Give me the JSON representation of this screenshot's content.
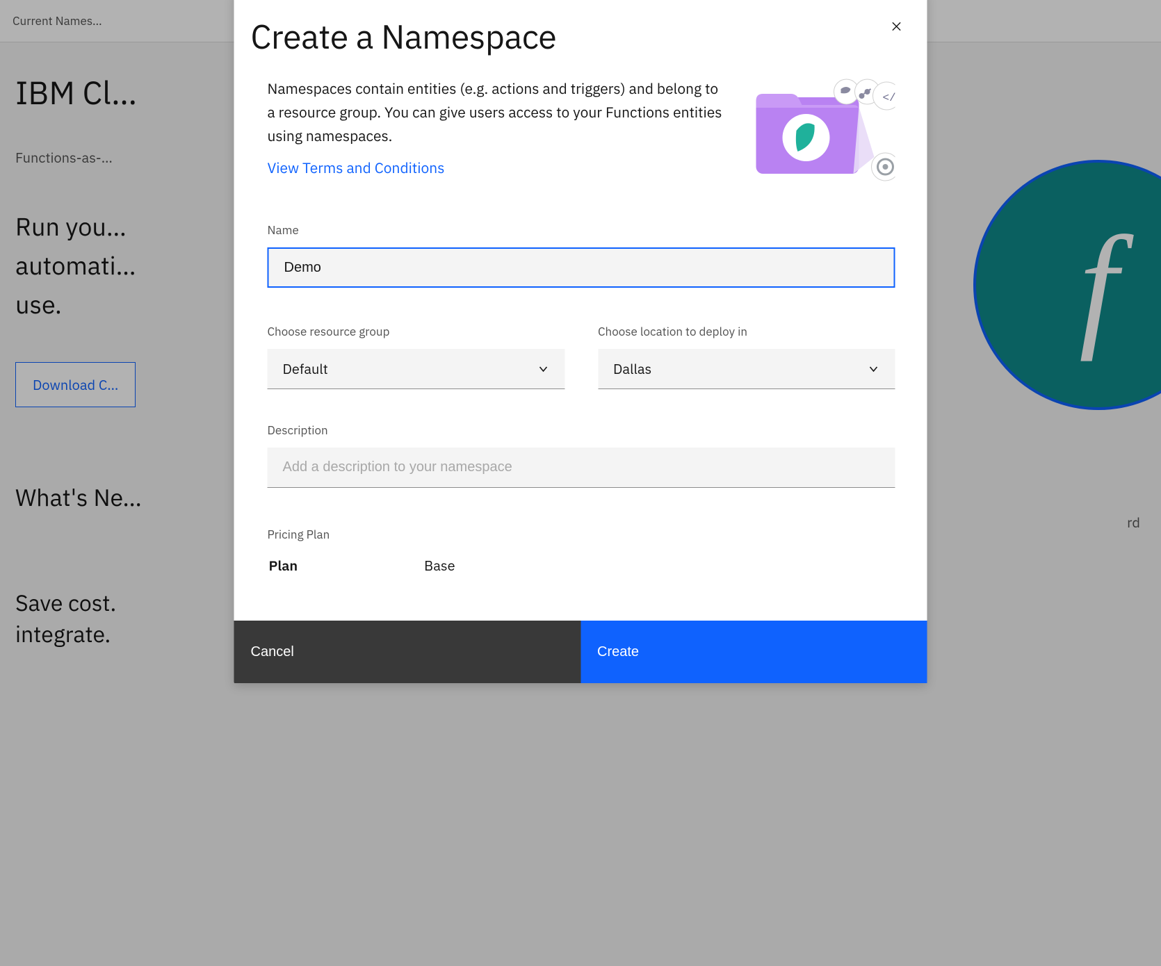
{
  "background": {
    "topbar": "Current Names…",
    "title": "IBM Cl…",
    "subtitle": "Functions-as-…",
    "desc_line1": "Run you…",
    "desc_line2": "automati…",
    "desc_line3": "use.",
    "download_btn": "Download C…",
    "whats_new": "What's Ne…",
    "tagline1": "Save cost.",
    "tagline2": "integrate.",
    "rd_tail": "rd"
  },
  "modal": {
    "title": "Create a Namespace",
    "intro": "Namespaces contain entities (e.g. actions and triggers) and belong to a resource group. You can give users access to your Functions entities using namespaces.",
    "terms_link": "View Terms and Conditions",
    "name": {
      "label": "Name",
      "value": "Demo"
    },
    "resource_group": {
      "label": "Choose resource group",
      "value": "Default"
    },
    "location": {
      "label": "Choose location to deploy in",
      "value": "Dallas"
    },
    "description": {
      "label": "Description",
      "placeholder": "Add a description to your namespace"
    },
    "pricing": {
      "label": "Pricing Plan",
      "col_plan": "Plan",
      "col_base": "Base"
    },
    "cancel": "Cancel",
    "create": "Create"
  }
}
